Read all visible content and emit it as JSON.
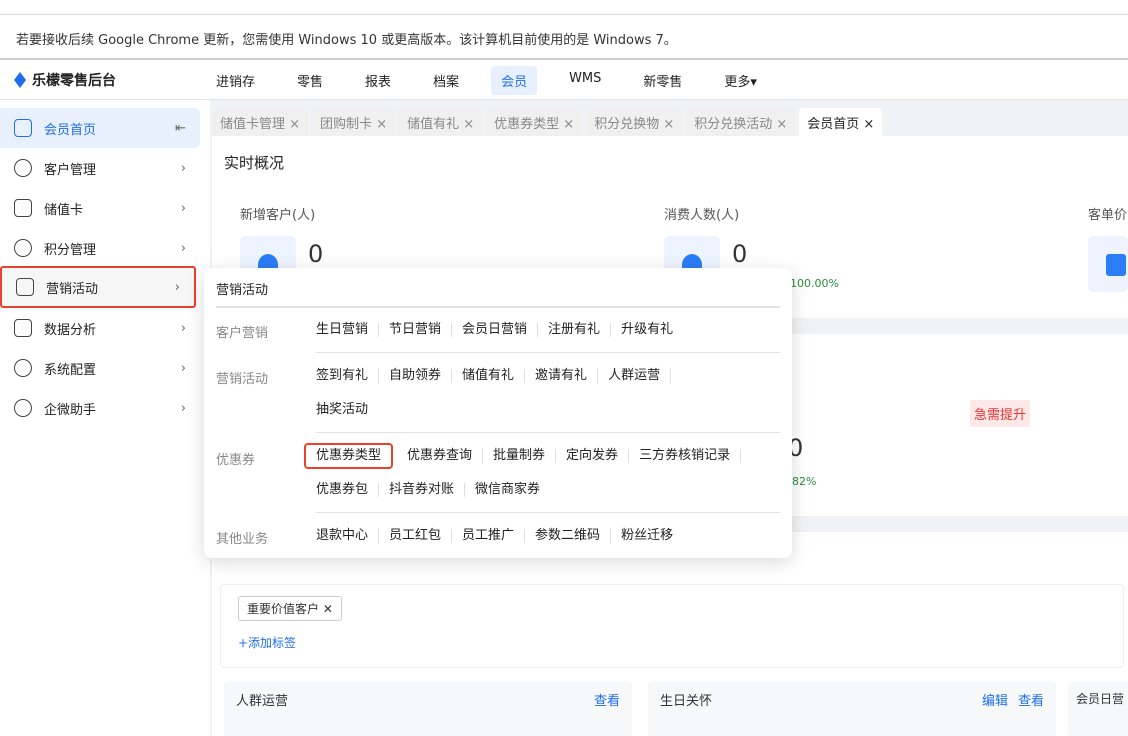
{
  "banner": "若要接收后续 Google Chrome 更新，您需使用 Windows 10 或更高版本。该计算机目前使用的是 Windows 7。",
  "logo": "乐檬零售后台",
  "nav": [
    "进销存",
    "零售",
    "报表",
    "档案",
    "会员",
    "WMS",
    "新零售",
    "更多▾"
  ],
  "sidebar": [
    {
      "label": "会员首页"
    },
    {
      "label": "客户管理"
    },
    {
      "label": "储值卡"
    },
    {
      "label": "积分管理"
    },
    {
      "label": "营销活动"
    },
    {
      "label": "数据分析"
    },
    {
      "label": "系统配置"
    },
    {
      "label": "企微助手"
    }
  ],
  "collapse": "⇤",
  "tabs": [
    "储值卡管理",
    "团购制卡",
    "储值有礼",
    "优惠券类型",
    "积分兑换物",
    "积分兑换活动",
    "会员首页"
  ],
  "overview": {
    "title": "实时概况",
    "new_customers": "新增客户(人)",
    "new_value": "0",
    "consumers": "消费人数(人)",
    "consumers_value": "0",
    "unit_price": "客单价",
    "pct1": "100.00%",
    "pct2": "82%",
    "badge": "急需提升",
    "zero": "0"
  },
  "tags": {
    "tag": "重要价值客户 ✕",
    "add": "+添加标签"
  },
  "panels": [
    {
      "title": "人群运营",
      "links": [
        "查看"
      ]
    },
    {
      "title": "生日关怀",
      "links": [
        "编辑",
        "查看"
      ]
    },
    {
      "title": "会员日营"
    }
  ],
  "popup": {
    "title": "营销活动",
    "groups": [
      {
        "cat": "客户营销",
        "rows": [
          [
            "生日营销",
            "节日营销",
            "会员日营销",
            "注册有礼",
            "升级有礼"
          ]
        ]
      },
      {
        "cat": "营销活动",
        "rows": [
          [
            "签到有礼",
            "自助领券",
            "储值有礼",
            "邀请有礼",
            "人群运营"
          ],
          [
            "抽奖活动"
          ]
        ]
      },
      {
        "cat": "优惠券",
        "rows": [
          [
            "优惠券类型",
            "优惠券查询",
            "批量制券",
            "定向发券",
            "三方券核销记录"
          ],
          [
            "优惠券包",
            "抖音券对账",
            "微信商家券"
          ]
        ]
      },
      {
        "cat": "其他业务",
        "rows": [
          [
            "退款中心",
            "员工红包",
            "员工推广",
            "参数二维码",
            "粉丝迁移"
          ]
        ]
      }
    ]
  }
}
